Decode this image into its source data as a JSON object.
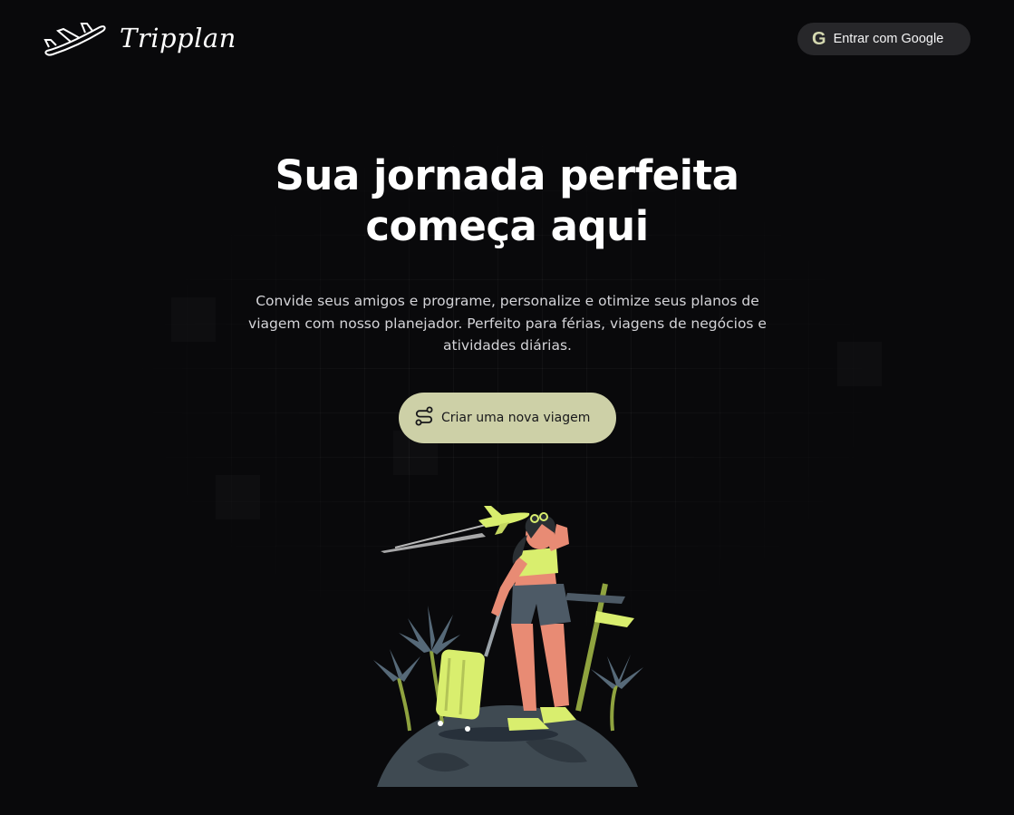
{
  "header": {
    "brand_name": "Tripplan",
    "logo_icon": "airplane-icon",
    "login_button": {
      "label": "Entrar com Google",
      "icon": "google-icon"
    }
  },
  "hero": {
    "title_line1": "Sua jornada perfeita",
    "title_line2": "começa aqui",
    "subtitle": "Convide seus amigos e programe, personalize e otimize seus planos de viagem com nosso planejador. Perfeito para férias, viagens de negócios e atividades diárias.",
    "cta": {
      "label": "Criar uma nova viagem",
      "icon": "route-icon"
    },
    "illustration": "traveler-on-globe-illustration"
  },
  "colors": {
    "background": "#09090b",
    "accent": "#cdd0a7",
    "button_dark": "#27272a",
    "illustration_lime": "#d9ee6e",
    "illustration_skin": "#e88b74"
  }
}
